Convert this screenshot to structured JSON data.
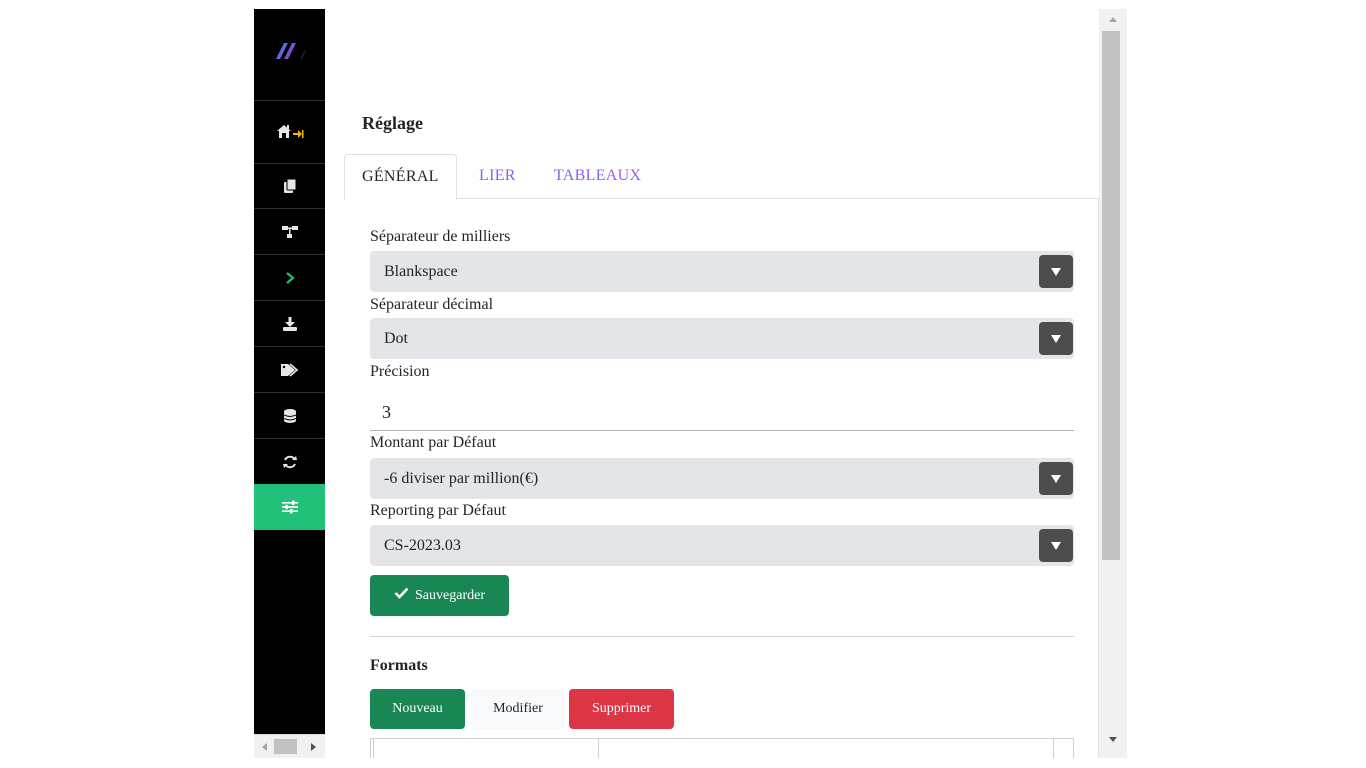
{
  "page": {
    "title": "Réglage"
  },
  "tabs": [
    {
      "label": "GÉNÉRAL",
      "active": true
    },
    {
      "label": "LIER",
      "active": false
    },
    {
      "label": "TABLEAUX",
      "active": false
    }
  ],
  "sidebar": {
    "items": [
      {
        "icon": "home-pin-icon"
      },
      {
        "icon": "copy-icon"
      },
      {
        "icon": "sitemap-icon"
      },
      {
        "icon": "chevron-right-icon"
      },
      {
        "icon": "download-icon"
      },
      {
        "icon": "tags-icon"
      },
      {
        "icon": "database-icon"
      },
      {
        "icon": "sync-icon"
      },
      {
        "icon": "sliders-icon",
        "active": true
      }
    ]
  },
  "form": {
    "thousands_label": "Séparateur de milliers",
    "thousands_value": "Blankspace",
    "decimal_label": "Séparateur décimal",
    "decimal_value": "Dot",
    "precision_label": "Précision",
    "precision_value": "3",
    "amount_label": "Montant par Défaut",
    "amount_value": "-6 diviser par million(€)",
    "reporting_label": "Reporting par Défaut",
    "reporting_value": "CS-2023.03",
    "save_label": "Sauvegarder"
  },
  "formats": {
    "title": "Formats",
    "new_label": "Nouveau",
    "edit_label": "Modifier",
    "delete_label": "Supprimer"
  },
  "colors": {
    "accent": "#21c17a",
    "primary_green": "#198754",
    "danger": "#dc3545",
    "tab_link": "#8f5fe8",
    "sidebar_bg": "#000000"
  }
}
